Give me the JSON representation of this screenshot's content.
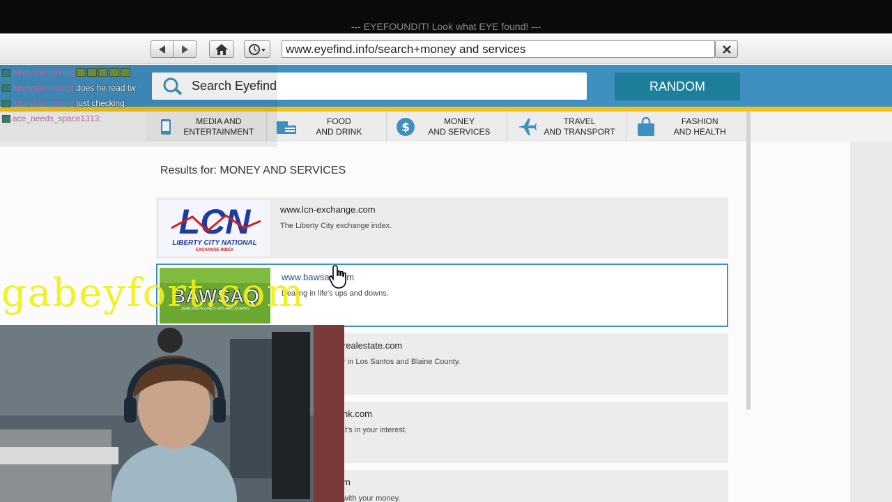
{
  "window": {
    "title": "--- EYEFOUNDIT! Look what EYE found! ---"
  },
  "browser": {
    "url": "www.eyefind.info/search+money and services"
  },
  "header": {
    "search_placeholder": "Search Eyefind",
    "random_label": "RANDOM"
  },
  "categories": [
    {
      "label": "MEDIA AND\nENTERTAINMENT",
      "icon": "media-icon"
    },
    {
      "label": "FOOD\nAND DRINK",
      "icon": "food-icon"
    },
    {
      "label": "MONEY\nAND SERVICES",
      "icon": "dollar-icon"
    },
    {
      "label": "TRAVEL\nAND TRANSPORT",
      "icon": "airplane-icon"
    },
    {
      "label": "FASHION\nAND HEALTH",
      "icon": "shopping-bag-icon"
    }
  ],
  "results_heading": "Results for: MONEY AND SERVICES",
  "results": [
    {
      "domain": "www.lcn-exchange.com",
      "desc": "The Liberty City exchange index.",
      "logo_text": "LCN",
      "logo_sub": "LIBERTY CITY NATIONAL",
      "logo_sub2": "EXCHANGE INDEX"
    },
    {
      "domain": "www.bawsaq.com",
      "desc": "Dealing in life's ups and downs.",
      "logo_text": "BAWSAQ",
      "logo_sub": "DEALING IN LIFE'S UPS AND DOWNS"
    },
    {
      "domain": "realestate.com",
      "desc": "r in Los Santos and Blaine County."
    },
    {
      "domain": "nk.com",
      "desc": "It's in your interest."
    },
    {
      "domain": "m",
      "desc": "with your money."
    }
  ],
  "chat": [
    {
      "user": "funnysalmonbigt",
      "msg": ""
    },
    {
      "user": "funnysalmonbigt",
      "msg": "does he read tw"
    },
    {
      "user": "funnysalmonbigt",
      "msg": "just checking"
    },
    {
      "user": "ace_needs_space1313:",
      "msg": ""
    }
  ],
  "watermark": "gabeyfort.com",
  "colors": {
    "header_blue": "#3f8fc0",
    "random_teal": "#1d7f99",
    "accent_yellow": "#f3c21d"
  }
}
